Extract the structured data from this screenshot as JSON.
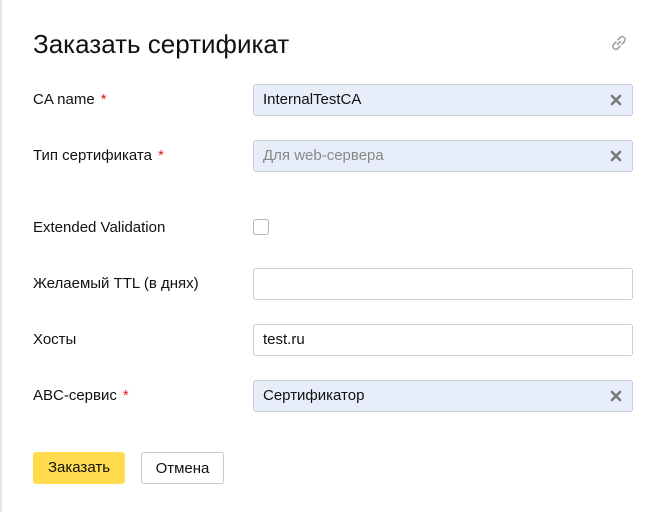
{
  "dialog": {
    "title": "Заказать сертификат",
    "link_icon": "link-icon"
  },
  "form": {
    "ca_name": {
      "label": "CA name",
      "required_mark": "*",
      "value": "InternalTestCA"
    },
    "cert_type": {
      "label": "Тип сертификата",
      "required_mark": "*",
      "placeholder": "Для web-сервера"
    },
    "extended_validation": {
      "label": "Extended Validation",
      "checked": false
    },
    "ttl": {
      "label": "Желаемый TTL (в днях)",
      "value": ""
    },
    "hosts": {
      "label": "Хосты",
      "value": "test.ru"
    },
    "abc_service": {
      "label": "ABC-сервис",
      "required_mark": "*",
      "value": "Сертификатор"
    }
  },
  "actions": {
    "submit_label": "Заказать",
    "cancel_label": "Отмена"
  },
  "colors": {
    "primary_button": "#ffdb4d",
    "selected_field_bg": "#e8eef9",
    "required": "#e01b1b"
  }
}
